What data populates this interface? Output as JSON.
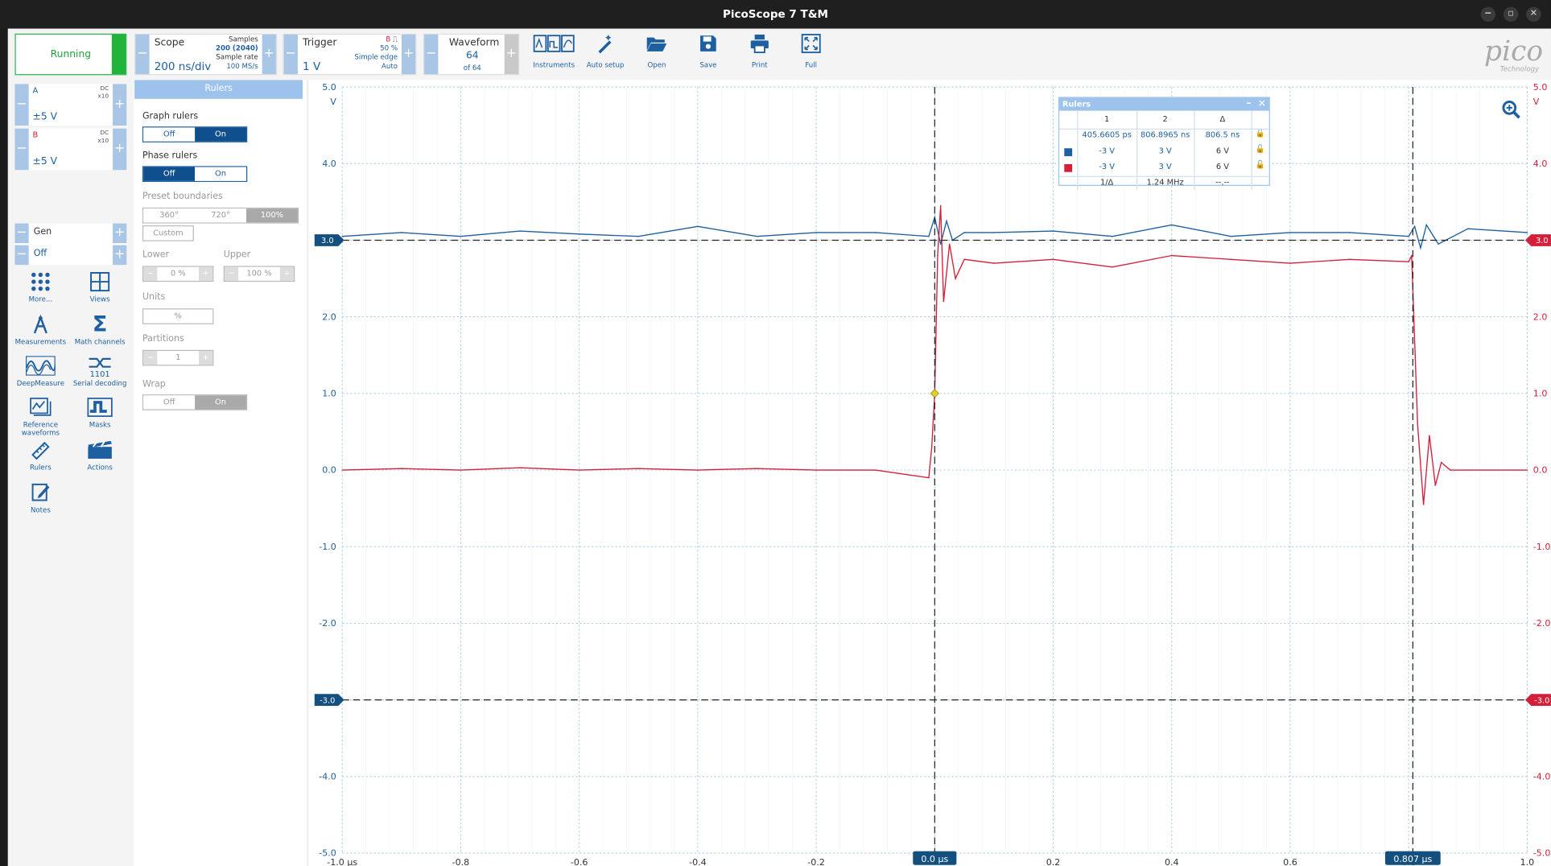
{
  "window": {
    "title": "PicoScope 7 T&M",
    "controls": [
      "−",
      "▫",
      "✕"
    ]
  },
  "status": {
    "run_label": "Running",
    "run_color": "#22b43a"
  },
  "scope": {
    "title": "Scope",
    "timebase": "200 ns/div",
    "samples_label": "Samples",
    "samples_value": "200 (2040)",
    "sample_rate_label": "Sample rate",
    "sample_rate_value": "100 MS/s"
  },
  "trigger": {
    "title": "Trigger",
    "channel": "B",
    "level": "1 V",
    "percent": "50 %",
    "type": "Simple edge",
    "mode": "Auto"
  },
  "waveform": {
    "title": "Waveform",
    "index": "64",
    "count": "of 64"
  },
  "toolbar": [
    {
      "icon": "instruments-icon",
      "label": "Instruments"
    },
    {
      "icon": "auto-setup-icon",
      "label": "Auto setup"
    },
    {
      "icon": "open-folder-icon",
      "label": "Open"
    },
    {
      "icon": "save-icon",
      "label": "Save"
    },
    {
      "icon": "print-icon",
      "label": "Print"
    },
    {
      "icon": "fullscreen-icon",
      "label": "Full"
    }
  ],
  "logo": {
    "text": "pico",
    "subtext": "Technology"
  },
  "channels": [
    {
      "name": "A",
      "coupling": "DC",
      "probe": "x10",
      "range": "±5 V",
      "color": "#1d5fa0"
    },
    {
      "name": "B",
      "coupling": "DC",
      "probe": "x10",
      "range": "±5 V",
      "color": "#d41f3a"
    }
  ],
  "gen": {
    "label": "Gen",
    "state": "Off"
  },
  "tools": [
    {
      "icon": "more-icon",
      "label": "More..."
    },
    {
      "icon": "views-icon",
      "label": "Views"
    },
    {
      "icon": "measurements-icon",
      "label": "Measurements"
    },
    {
      "icon": "math-channels-icon",
      "label": "Math channels"
    },
    {
      "icon": "deepmeasure-icon",
      "label": "DeepMeasure"
    },
    {
      "icon": "serial-decoding-icon",
      "label": "Serial decoding"
    },
    {
      "icon": "reference-waveforms-icon",
      "label": "Reference waveforms"
    },
    {
      "icon": "masks-icon",
      "label": "Masks"
    },
    {
      "icon": "rulers-icon",
      "label": "Rulers"
    },
    {
      "icon": "actions-icon",
      "label": "Actions"
    },
    {
      "icon": "notes-icon",
      "label": "Notes"
    }
  ],
  "rulers_panel": {
    "title": "Rulers",
    "graph_rulers": {
      "label": "Graph rulers",
      "off": "Off",
      "on": "On",
      "selected": "On"
    },
    "phase_rulers": {
      "label": "Phase rulers",
      "off": "Off",
      "on": "On",
      "selected": "Off"
    },
    "preset_boundaries": {
      "label": "Preset boundaries",
      "options": [
        "360°",
        "720°",
        "100%"
      ],
      "selected": "100%",
      "custom": "Custom"
    },
    "lower": {
      "label": "Lower",
      "value": "0 %"
    },
    "upper": {
      "label": "Upper",
      "value": "100 %"
    },
    "units": {
      "label": "Units",
      "value": "%"
    },
    "partitions": {
      "label": "Partitions",
      "value": "1"
    },
    "wrap": {
      "label": "Wrap",
      "off": "Off",
      "on": "On",
      "selected": "On"
    }
  },
  "rulers_popup": {
    "title": "Rulers",
    "headers": [
      "1",
      "2",
      "Δ"
    ],
    "time_row": [
      "405.6605 ps",
      "806.8965 ns",
      "806.5 ns"
    ],
    "rows": [
      {
        "color": "#1d5fa0",
        "r1": "-3 V",
        "r2": "3 V",
        "delta": "6 V"
      },
      {
        "color": "#d41f3a",
        "r1": "-3 V",
        "r2": "3 V",
        "delta": "6 V"
      }
    ],
    "inv_label": "1/Δ",
    "inv_value": "1.24 MHz",
    "inv_phase": "--.--"
  },
  "chart_data": {
    "type": "line",
    "x_unit": "μs",
    "y_unit": "V",
    "xlim": [
      -1.0,
      1.0
    ],
    "ylim": [
      -5.0,
      5.0
    ],
    "x_ticks": [
      "-1.0 μs",
      "-0.8",
      "-0.6",
      "-0.4",
      "-0.2",
      "0.0",
      "0.2",
      "0.4",
      "0.6",
      "0.8",
      "1.0"
    ],
    "x_tick_values": [
      -1.0,
      -0.8,
      -0.6,
      -0.4,
      -0.2,
      0.0,
      0.2,
      0.4,
      0.6,
      0.8,
      1.0
    ],
    "y_ticks": [
      "5.0",
      "4.0",
      "3.0",
      "2.0",
      "1.0",
      "0.0",
      "-1.0",
      "-2.0",
      "-3.0",
      "-4.0",
      "-5.0"
    ],
    "y_tick_values": [
      5,
      4,
      3,
      2,
      1,
      0,
      -1,
      -2,
      -3,
      -4,
      -5
    ],
    "grid": true,
    "series": [
      {
        "name": "A",
        "color": "#1d5fa0",
        "x": [
          -1.0,
          -0.9,
          -0.8,
          -0.7,
          -0.6,
          -0.5,
          -0.4,
          -0.3,
          -0.2,
          -0.1,
          -0.01,
          0.0,
          0.01,
          0.02,
          0.03,
          0.05,
          0.1,
          0.2,
          0.3,
          0.4,
          0.5,
          0.6,
          0.7,
          0.8,
          0.81,
          0.82,
          0.83,
          0.85,
          0.9,
          1.0
        ],
        "values": [
          3.05,
          3.1,
          3.05,
          3.12,
          3.08,
          3.05,
          3.18,
          3.05,
          3.1,
          3.1,
          3.05,
          3.3,
          2.95,
          3.25,
          3.0,
          3.1,
          3.1,
          3.12,
          3.05,
          3.2,
          3.05,
          3.1,
          3.1,
          3.05,
          3.18,
          2.9,
          3.2,
          2.95,
          3.15,
          3.1
        ]
      },
      {
        "name": "B",
        "color": "#d41f3a",
        "x": [
          -1.0,
          -0.9,
          -0.8,
          -0.7,
          -0.6,
          -0.5,
          -0.4,
          -0.3,
          -0.2,
          -0.1,
          -0.01,
          -0.005,
          0.0,
          0.005,
          0.01,
          0.015,
          0.025,
          0.035,
          0.05,
          0.1,
          0.2,
          0.3,
          0.4,
          0.5,
          0.6,
          0.7,
          0.8,
          0.805,
          0.815,
          0.825,
          0.835,
          0.845,
          0.855,
          0.87,
          0.9,
          1.0
        ],
        "values": [
          0.0,
          0.02,
          0.0,
          0.03,
          0.0,
          0.02,
          0.0,
          0.02,
          0.0,
          0.0,
          -0.1,
          0.3,
          1.0,
          2.8,
          3.45,
          2.2,
          2.95,
          2.5,
          2.75,
          2.7,
          2.75,
          2.65,
          2.8,
          2.75,
          2.7,
          2.75,
          2.72,
          2.8,
          0.6,
          -0.45,
          0.45,
          -0.2,
          0.1,
          0.0,
          0.0,
          0.0
        ]
      }
    ],
    "rulers": {
      "time": [
        {
          "x": 0.0,
          "label": "0.0 μs"
        },
        {
          "x": 0.807,
          "label": "0.807 μs"
        }
      ],
      "voltage": [
        {
          "y": 3.0,
          "label": "3.0"
        },
        {
          "y": -3.0,
          "label": "-3.0"
        }
      ]
    },
    "trigger_marker": {
      "x": 0.0,
      "y": 1.0,
      "color": "#e8d02a"
    }
  }
}
